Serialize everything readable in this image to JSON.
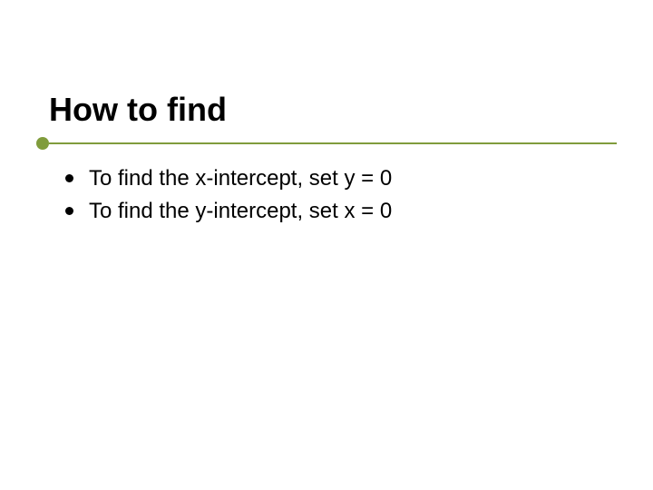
{
  "title": "How to find",
  "bullets": [
    "To find the x-intercept, set y = 0",
    "To find the y-intercept, set x = 0"
  ]
}
